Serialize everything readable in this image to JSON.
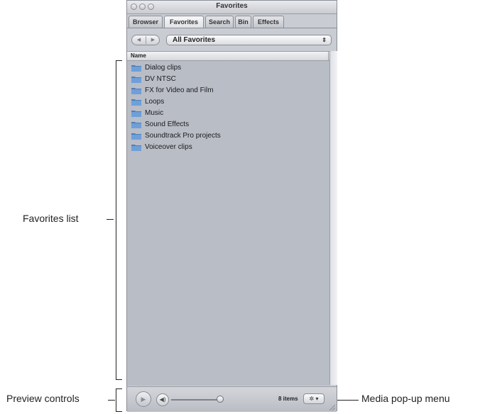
{
  "window": {
    "title": "Favorites",
    "tabs": [
      {
        "label": "Browser"
      },
      {
        "label": "Favorites"
      },
      {
        "label": "Search"
      },
      {
        "label": "Bin"
      },
      {
        "label": "Effects"
      }
    ],
    "active_tab": "Favorites",
    "popup": {
      "value": "All Favorites"
    },
    "list": {
      "column_header": "Name",
      "items": [
        {
          "label": "Dialog clips",
          "icon": "folder-icon"
        },
        {
          "label": "DV NTSC",
          "icon": "folder-icon"
        },
        {
          "label": "FX for Video and Film",
          "icon": "folder-icon"
        },
        {
          "label": "Loops",
          "icon": "folder-icon"
        },
        {
          "label": "Music",
          "icon": "folder-icon"
        },
        {
          "label": "Sound Effects",
          "icon": "folder-icon"
        },
        {
          "label": "Soundtrack Pro projects",
          "icon": "folder-icon"
        },
        {
          "label": "Voiceover clips",
          "icon": "folder-icon"
        }
      ]
    },
    "bottom": {
      "item_count": "8 items",
      "volume_level": 0.95
    }
  },
  "callouts": {
    "favorites_list": "Favorites list",
    "preview_controls": "Preview controls",
    "media_popup": "Media pop-up menu"
  },
  "colors": {
    "panel_bg": "#b9bdc6",
    "folder_blue": "#4a7fc0"
  }
}
